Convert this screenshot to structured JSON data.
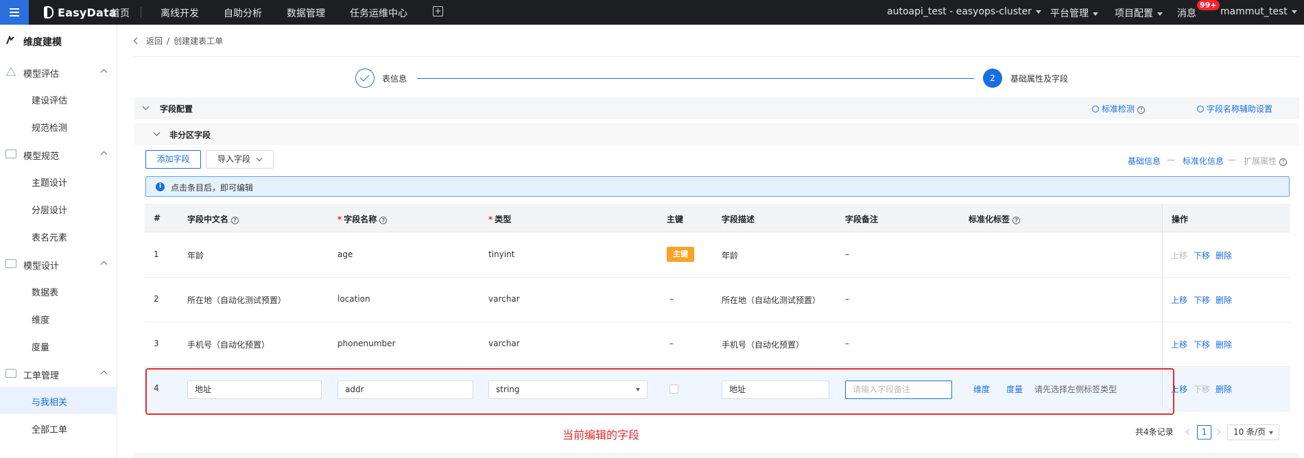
{
  "topbar": {
    "brand": "EasyData",
    "nav": [
      "首页",
      "离线开发",
      "自助分析",
      "数据管理",
      "任务运维中心"
    ],
    "cluster": "autoapi_test - easyops-cluster",
    "platform_menu": "平台管理",
    "project_menu": "项目配置",
    "messages": "消息",
    "message_badge": "99+",
    "user": "mammut_test"
  },
  "sidebar": {
    "title": "维度建模",
    "groups": [
      {
        "label": "模型评估",
        "items": [
          "建设评估",
          "规范检测"
        ]
      },
      {
        "label": "模型规范",
        "items": [
          "主题设计",
          "分层设计",
          "表名元素"
        ]
      },
      {
        "label": "模型设计",
        "items": [
          "数据表",
          "维度",
          "度量"
        ]
      },
      {
        "label": "工单管理",
        "items": [
          "与我相关",
          "全部工单"
        ]
      }
    ],
    "active_item": "与我相关"
  },
  "breadcrumb": {
    "back": "返回",
    "separator": "/",
    "current": "创建建表工单"
  },
  "steps": [
    {
      "label": "表信息",
      "status": "done"
    },
    {
      "number": "2",
      "label": "基础属性及字段",
      "status": "active"
    }
  ],
  "section": {
    "title": "字段配置",
    "std_check": "标准检测",
    "name_assist": "字段名称辅助设置",
    "sub_title": "非分区字段"
  },
  "toolbar": {
    "add_field": "添加字段",
    "import_field": "导入字段",
    "tab_basic": "基础信息",
    "tab_standard": "标准化信息",
    "tab_ext": "扩展属性",
    "tab_sep": "—"
  },
  "info_text": "点击条目后，即可编辑",
  "table": {
    "headers": {
      "index": "#",
      "cn_name": "字段中文名",
      "name": "字段名称",
      "type": "类型",
      "pk": "主键",
      "desc": "字段描述",
      "remark": "字段备注",
      "tag": "标准化标签",
      "ops": "操作"
    },
    "rows": [
      {
        "index": "1",
        "cn_name": "年龄",
        "name": "age",
        "type": "tinyint",
        "pk": "主键",
        "desc": "年龄",
        "remark": "–"
      },
      {
        "index": "2",
        "cn_name": "所在地（自动化测试预置）",
        "name": "location",
        "type": "varchar",
        "pk": "–",
        "desc": "所在地（自动化测试预置）",
        "remark": "–"
      },
      {
        "index": "3",
        "cn_name": "手机号（自动化预置）",
        "name": "phonenumber",
        "type": "varchar",
        "pk": "–",
        "desc": "手机号（自动化预置）",
        "remark": "–"
      }
    ],
    "editing_row": {
      "index": "4",
      "cn_name": "地址",
      "name": "addr",
      "type": "string",
      "desc": "地址",
      "remark_placeholder": "请输入字段备注",
      "tag_dimension": "维度",
      "tag_measure": "度量",
      "tag_hint": "请先选择左侧标签类型"
    },
    "ops": {
      "up": "上移",
      "down": "下移",
      "delete": "删除"
    }
  },
  "annotation": "当前编辑的字段",
  "pager": {
    "total": "共4条记录",
    "page": "1",
    "size": "10 条/页"
  },
  "colors": {
    "accent": "#1a6fe0",
    "pk_tag": "#f7a325",
    "highlight": "#e52b2b",
    "topbar": "#1d1e22"
  }
}
